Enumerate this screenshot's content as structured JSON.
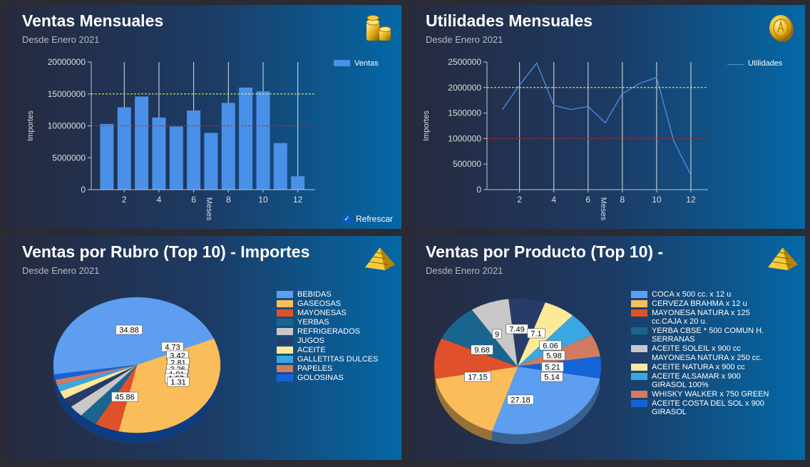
{
  "colors": {
    "bar": "#4a90e8",
    "line": "#4a90e8",
    "goal": "#ffff33",
    "threshold": "#cc2222",
    "axis_text": "#dddddd",
    "grid": "#ffffff"
  },
  "panels": [
    {
      "title": "Ventas Mensuales",
      "subtitle": "Desde Enero 2021",
      "icon": "coin-stack-icon",
      "refresh_label": "Refrescar"
    },
    {
      "title": "Utilidades Mensuales",
      "subtitle": "Desde Enero 2021",
      "icon": "gold-coin-icon"
    },
    {
      "title": "Ventas por Rubro (Top 10) - Importes",
      "subtitle": "Desde Enero 2021",
      "icon": "pyramid-icon"
    },
    {
      "title": "Ventas por Producto (Top 10) -",
      "subtitle": "Desde Enero 2021",
      "icon": "pyramid-icon"
    }
  ],
  "chart_data": [
    {
      "type": "bar",
      "title": "Ventas Mensuales",
      "xlabel": "Meses",
      "ylabel": "Importes",
      "x": [
        1,
        2,
        3,
        4,
        5,
        6,
        7,
        8,
        9,
        10,
        11,
        12
      ],
      "x_ticks": [
        "2",
        "4",
        "6",
        "8",
        "10",
        "12"
      ],
      "y_ticks": [
        "0",
        "5000000",
        "10000000",
        "15000000",
        "20000000"
      ],
      "ylim": [
        0,
        20000000
      ],
      "series": [
        {
          "name": "Ventas",
          "values": [
            10300000,
            12900000,
            14600000,
            11300000,
            9900000,
            12400000,
            8900000,
            13600000,
            16000000,
            15400000,
            7300000,
            2100000
          ]
        }
      ],
      "reference_lines": [
        15000000,
        10000000
      ],
      "grid": "vertical",
      "legend": "top-right"
    },
    {
      "type": "line",
      "title": "Utilidades Mensuales",
      "xlabel": "Meses",
      "ylabel": "Importes",
      "x": [
        1,
        2,
        3,
        4,
        5,
        6,
        7,
        8,
        9,
        10,
        11,
        12
      ],
      "x_ticks": [
        "2",
        "4",
        "6",
        "8",
        "10",
        "12"
      ],
      "y_ticks": [
        "0",
        "500000",
        "1000000",
        "1500000",
        "2000000",
        "2500000"
      ],
      "ylim": [
        0,
        2500000
      ],
      "series": [
        {
          "name": "Utilidades",
          "values": [
            1570000,
            2050000,
            2480000,
            1650000,
            1570000,
            1630000,
            1310000,
            1880000,
            2080000,
            2200000,
            950000,
            290000
          ]
        }
      ],
      "reference_lines": [
        2000000,
        1000000
      ],
      "grid": "vertical",
      "legend": "top-right"
    },
    {
      "type": "pie",
      "title": "Ventas por Rubro (Top 10) - Importes",
      "categories": [
        "BEBIDAS",
        "GASEOSAS",
        "MAYONESAS",
        "YERBAS",
        "REFRIGERADOS",
        "JUGOS",
        "ACEITE",
        "GALLETITAS DULCES",
        "PAPELES",
        "GOLOSINAS"
      ],
      "values": [
        45.86,
        34.88,
        4.73,
        3.42,
        2.81,
        2.26,
        1.91,
        1.57,
        1.31,
        1.25
      ],
      "labels": [
        "45.86",
        "34.88",
        "4.73",
        "3.42",
        "2.81",
        "2.26",
        "1.91",
        "1.57",
        "1.31",
        ""
      ],
      "colors": [
        "#5e9ef0",
        "#fbbd5a",
        "#e0502a",
        "#1a6490",
        "#c8c8c8",
        "#283c6a",
        "#fde99a",
        "#3aa6e2",
        "#d27a62",
        "#1464d8"
      ],
      "legend": "right"
    },
    {
      "type": "pie",
      "title": "Ventas por Producto (Top 10) -",
      "categories": [
        "COCA x 500 cc. x 12 u",
        "CERVEZA BRAHMA x 12 u",
        "MAYONESA NATURA x 125 cc.CAJA x 20 u.",
        "YERBA CBSE * 500 COMUN H. SERRANAS",
        "ACEITE SOLEIL x 900 cc",
        "MAYONESA NATURA x 250 cc.",
        "ACEITE NATURA x 900 cc",
        "ACEITE ALSAMAR x 900 GIRASOL 100%",
        "WHISKY WALKER x 750 GREEN",
        "ACEITE COSTA DEL SOL x 900 GIRASOL"
      ],
      "values": [
        27.18,
        17.15,
        9.68,
        9,
        7.49,
        7.1,
        6.06,
        5.98,
        5.21,
        5.14
      ],
      "labels": [
        "27.18",
        "17.15",
        "9.68",
        "9",
        "7.49",
        "7.1",
        "6.06",
        "5.98",
        "5.21",
        "5.14"
      ],
      "colors": [
        "#5e9ef0",
        "#fbbd5a",
        "#e0502a",
        "#1a6490",
        "#c8c8c8",
        "#283c6a",
        "#fde99a",
        "#3aa6e2",
        "#d27a62",
        "#1464d8"
      ],
      "legend": "right"
    }
  ]
}
